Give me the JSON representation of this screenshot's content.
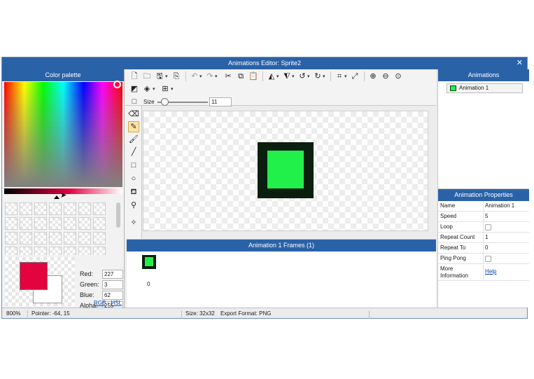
{
  "window": {
    "title": "Animations Editor: Sprite2",
    "close_glyph": "✕"
  },
  "palette": {
    "header": "Color palette",
    "red_label": "Red:",
    "red": "227",
    "green_label": "Green:",
    "green": "3",
    "blue_label": "Blue:",
    "blue": "62",
    "alpha_label": "Alpha:",
    "alpha": "255",
    "rgb_link": "RGB",
    "mode_separator": "-",
    "hsl_link": "HSL",
    "foreground_color": "#e3033e",
    "background_color": "#ffffff"
  },
  "toolbar": {
    "icons": [
      "new-file-icon",
      "open-folder-icon",
      "save-icon",
      "export-icon",
      "undo-icon",
      "redo-icon",
      "cut-icon",
      "copy-icon",
      "paste-icon",
      "flip-horizontal-icon",
      "flip-vertical-icon",
      "rotate-left-icon",
      "rotate-right-icon",
      "crop-icon",
      "resize-icon",
      "zoom-in-icon",
      "zoom-out-icon",
      "zoom-fit-icon",
      "fill-mode-icon",
      "layers-icon",
      "grid-icon"
    ],
    "size_label": "Size",
    "size_value": "11",
    "size_level": 11
  },
  "tools": [
    "eraser-icon",
    "pencil-icon",
    "brush-icon",
    "line-icon",
    "rectangle-icon",
    "ellipse-icon",
    "fill-bucket-icon",
    "eyedropper-icon",
    "magic-wand-icon"
  ],
  "canvas": {
    "sprite_border_color": "#0b1f0e",
    "sprite_fill_color": "#22f04a"
  },
  "frames": {
    "header": "Animation 1 Frames (1)",
    "items": [
      {
        "index_label": "0"
      }
    ]
  },
  "animations": {
    "header": "Animations",
    "items": [
      {
        "label": "Animation 1"
      }
    ]
  },
  "properties": {
    "header": "Animation Properties",
    "rows": [
      {
        "key": "Name",
        "value": "Animation 1"
      },
      {
        "key": "Speed",
        "value": "5"
      },
      {
        "key": "Loop",
        "checked": false
      },
      {
        "key": "Repeat Count",
        "value": "1"
      },
      {
        "key": "Repeat To",
        "value": "0"
      },
      {
        "key": "Ping Pong",
        "checked": false
      },
      {
        "key": "More Information",
        "link": "Help"
      }
    ]
  },
  "status": {
    "zoom": "800%",
    "pointer": "Pointer: -64, 15",
    "size": "Size: 32x32",
    "export_format": "Export Format: PNG"
  },
  "colors": {
    "titlebar": "#2a62a8",
    "accent_link": "#0645ad",
    "active_tool": "#fbe3a6"
  }
}
